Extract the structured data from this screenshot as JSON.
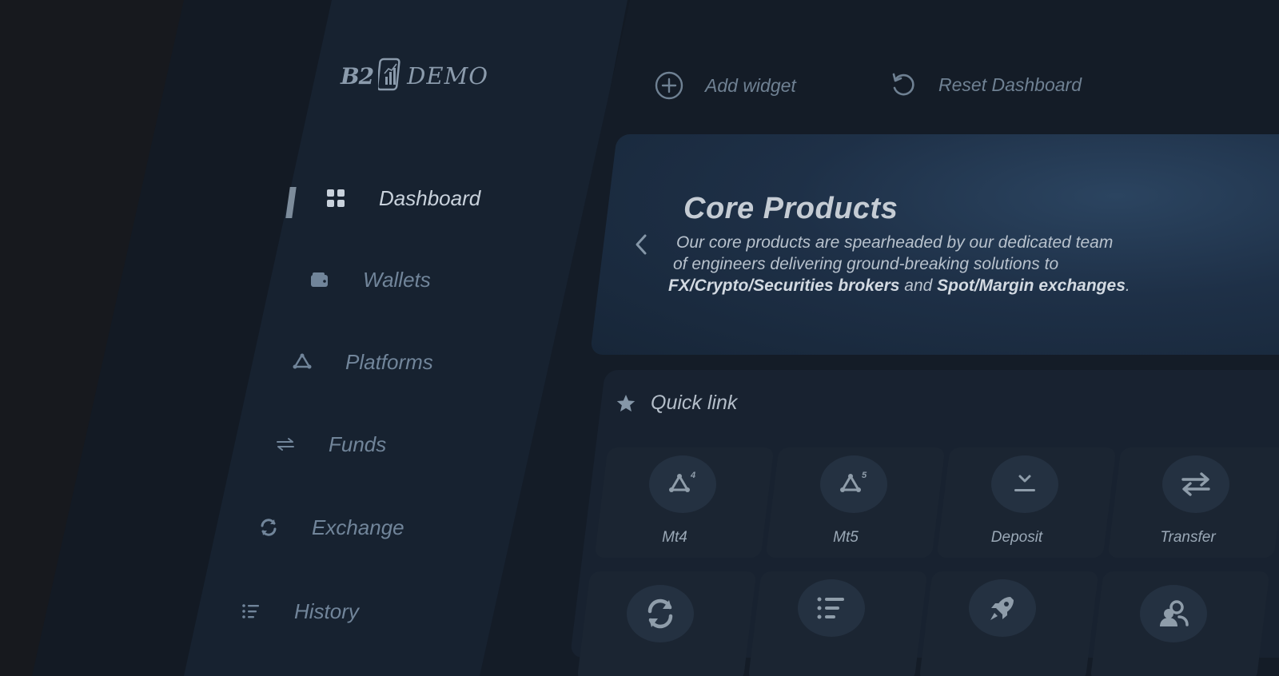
{
  "app": {
    "logo_b2": "B2",
    "logo_demo": "DEMO"
  },
  "toolbar": {
    "add_widget": "Add widget",
    "reset_dashboard": "Reset Dashboard"
  },
  "sidebar": {
    "items": [
      {
        "label": "Dashboard",
        "icon": "grid-icon",
        "active": true
      },
      {
        "label": "Wallets",
        "icon": "wallet-icon",
        "active": false
      },
      {
        "label": "Platforms",
        "icon": "platforms-icon",
        "active": false
      },
      {
        "label": "Funds",
        "icon": "arrows-exchange-icon",
        "active": false
      },
      {
        "label": "Exchange",
        "icon": "refresh-icon",
        "active": false
      },
      {
        "label": "History",
        "icon": "list-icon",
        "active": false
      }
    ]
  },
  "banner": {
    "title": "Core Products",
    "line1": "Our core products are spearheaded by our dedicated team",
    "line2": "of engineers delivering ground-breaking solutions to",
    "bold1": "FX/Crypto/Securities brokers",
    "mid": " and ",
    "bold2": "Spot/Margin exchanges",
    "end": "."
  },
  "quick_link": {
    "title": "Quick link",
    "tiles": [
      {
        "label": "Mt4",
        "icon": "mt4-icon",
        "badge": "4"
      },
      {
        "label": "Mt5",
        "icon": "mt5-icon",
        "badge": "5"
      },
      {
        "label": "Deposit",
        "icon": "deposit-icon"
      },
      {
        "label": "Transfer",
        "icon": "transfer-icon"
      },
      {
        "label": "",
        "icon": "refresh-icon"
      },
      {
        "label": "",
        "icon": "list-icon"
      },
      {
        "label": "",
        "icon": "rocket-icon"
      },
      {
        "label": "",
        "icon": "users-icon"
      }
    ]
  },
  "colors": {
    "background": "#16181d",
    "sidebar": "#172230",
    "main": "#141c27",
    "banner_accent": "#2b4460",
    "active_text": "#c9d2dc",
    "muted_text": "#71859a"
  }
}
